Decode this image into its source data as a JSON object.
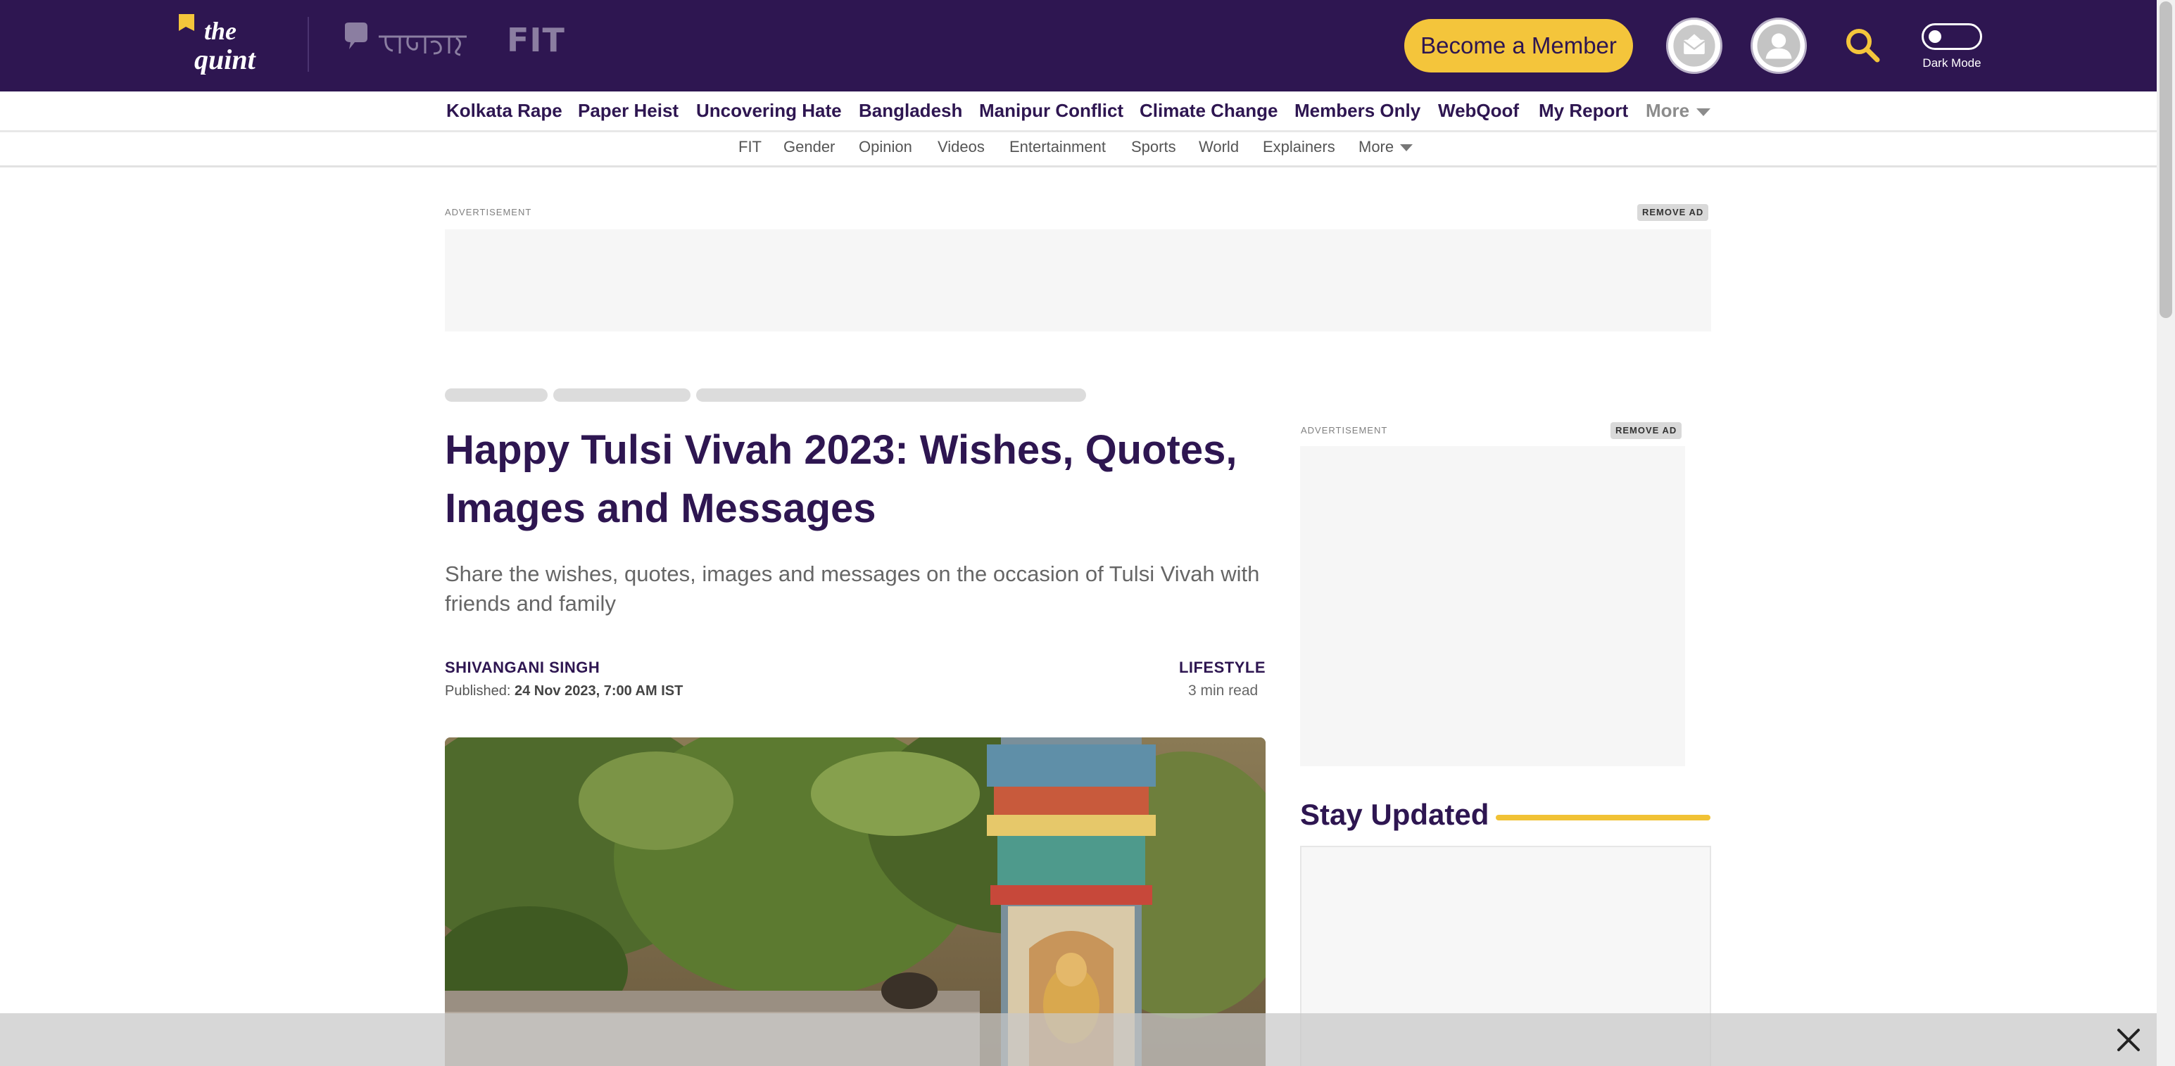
{
  "header": {
    "brand_the": "the",
    "brand_quint": "quint",
    "brand_fit": "FIT",
    "member_button": "Become a Member",
    "dark_mode_label": "Dark Mode"
  },
  "primary_nav": {
    "items": [
      "Kolkata Rape",
      "Paper Heist",
      "Uncovering Hate",
      "Bangladesh",
      "Manipur Conflict",
      "Climate Change",
      "Members Only",
      "WebQoof",
      "My Report"
    ],
    "more": "More"
  },
  "secondary_nav": {
    "items": [
      "FIT",
      "Gender",
      "Opinion",
      "Videos",
      "Entertainment",
      "Sports",
      "World",
      "Explainers"
    ],
    "more": "More"
  },
  "ads": {
    "label": "ADVERTISEMENT",
    "remove": "REMOVE AD"
  },
  "article": {
    "title": "Happy Tulsi Vivah 2023: Wishes, Quotes, Images and Messages",
    "dek": "Share the wishes, quotes, images and messages on the occasion of Tulsi Vivah with friends and family",
    "author": "SHIVANGANI SINGH",
    "published_label": "Published:",
    "published_date": "24 Nov 2023, 7:00 AM IST",
    "section": "LIFESTYLE",
    "read_time": "3 min read"
  },
  "sidebar": {
    "stay_updated": "Stay Updated"
  },
  "icons": {
    "newsletter": "newsletter-icon",
    "profile": "user-icon",
    "search": "search-icon",
    "close": "close-icon"
  },
  "colors": {
    "brand_purple": "#2e1651",
    "brand_yellow": "#f4c53b"
  }
}
